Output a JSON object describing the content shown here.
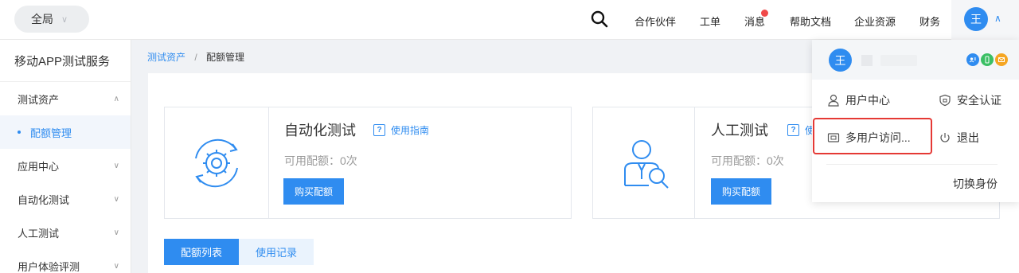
{
  "topbar": {
    "scope_label": "全局",
    "nav": [
      "合作伙伴",
      "工单",
      "消息",
      "帮助文档",
      "企业资源",
      "财务"
    ],
    "user_avatar": "王"
  },
  "sidebar": {
    "title": "移动APP测试服务",
    "items": [
      {
        "label": "测试资产",
        "expanded": true
      },
      {
        "label": "配额管理",
        "sub": true
      },
      {
        "label": "应用中心"
      },
      {
        "label": "自动化测试"
      },
      {
        "label": "人工测试"
      },
      {
        "label": "用户体验评测"
      }
    ]
  },
  "breadcrumb": {
    "parent": "测试资产",
    "separator": "/",
    "current": "配额管理"
  },
  "cards": [
    {
      "name": "自动化测试",
      "guide": "使用指南",
      "quota": "可用配额：0次",
      "buy": "购买配额"
    },
    {
      "name": "人工测试",
      "guide": "使",
      "quota": "可用配额：0次",
      "buy": "购买配额"
    }
  ],
  "tabs": [
    "配额列表",
    "使用记录"
  ],
  "dropdown": {
    "avatar": "王",
    "user_center": "用户中心",
    "security": "安全认证",
    "multi_user": "多用户访问...",
    "logout": "退出",
    "switch_identity": "切换身份"
  },
  "colors": {
    "accent": "#2f8cf0",
    "highlight": "#e53935",
    "notify": "#f04a4a"
  }
}
